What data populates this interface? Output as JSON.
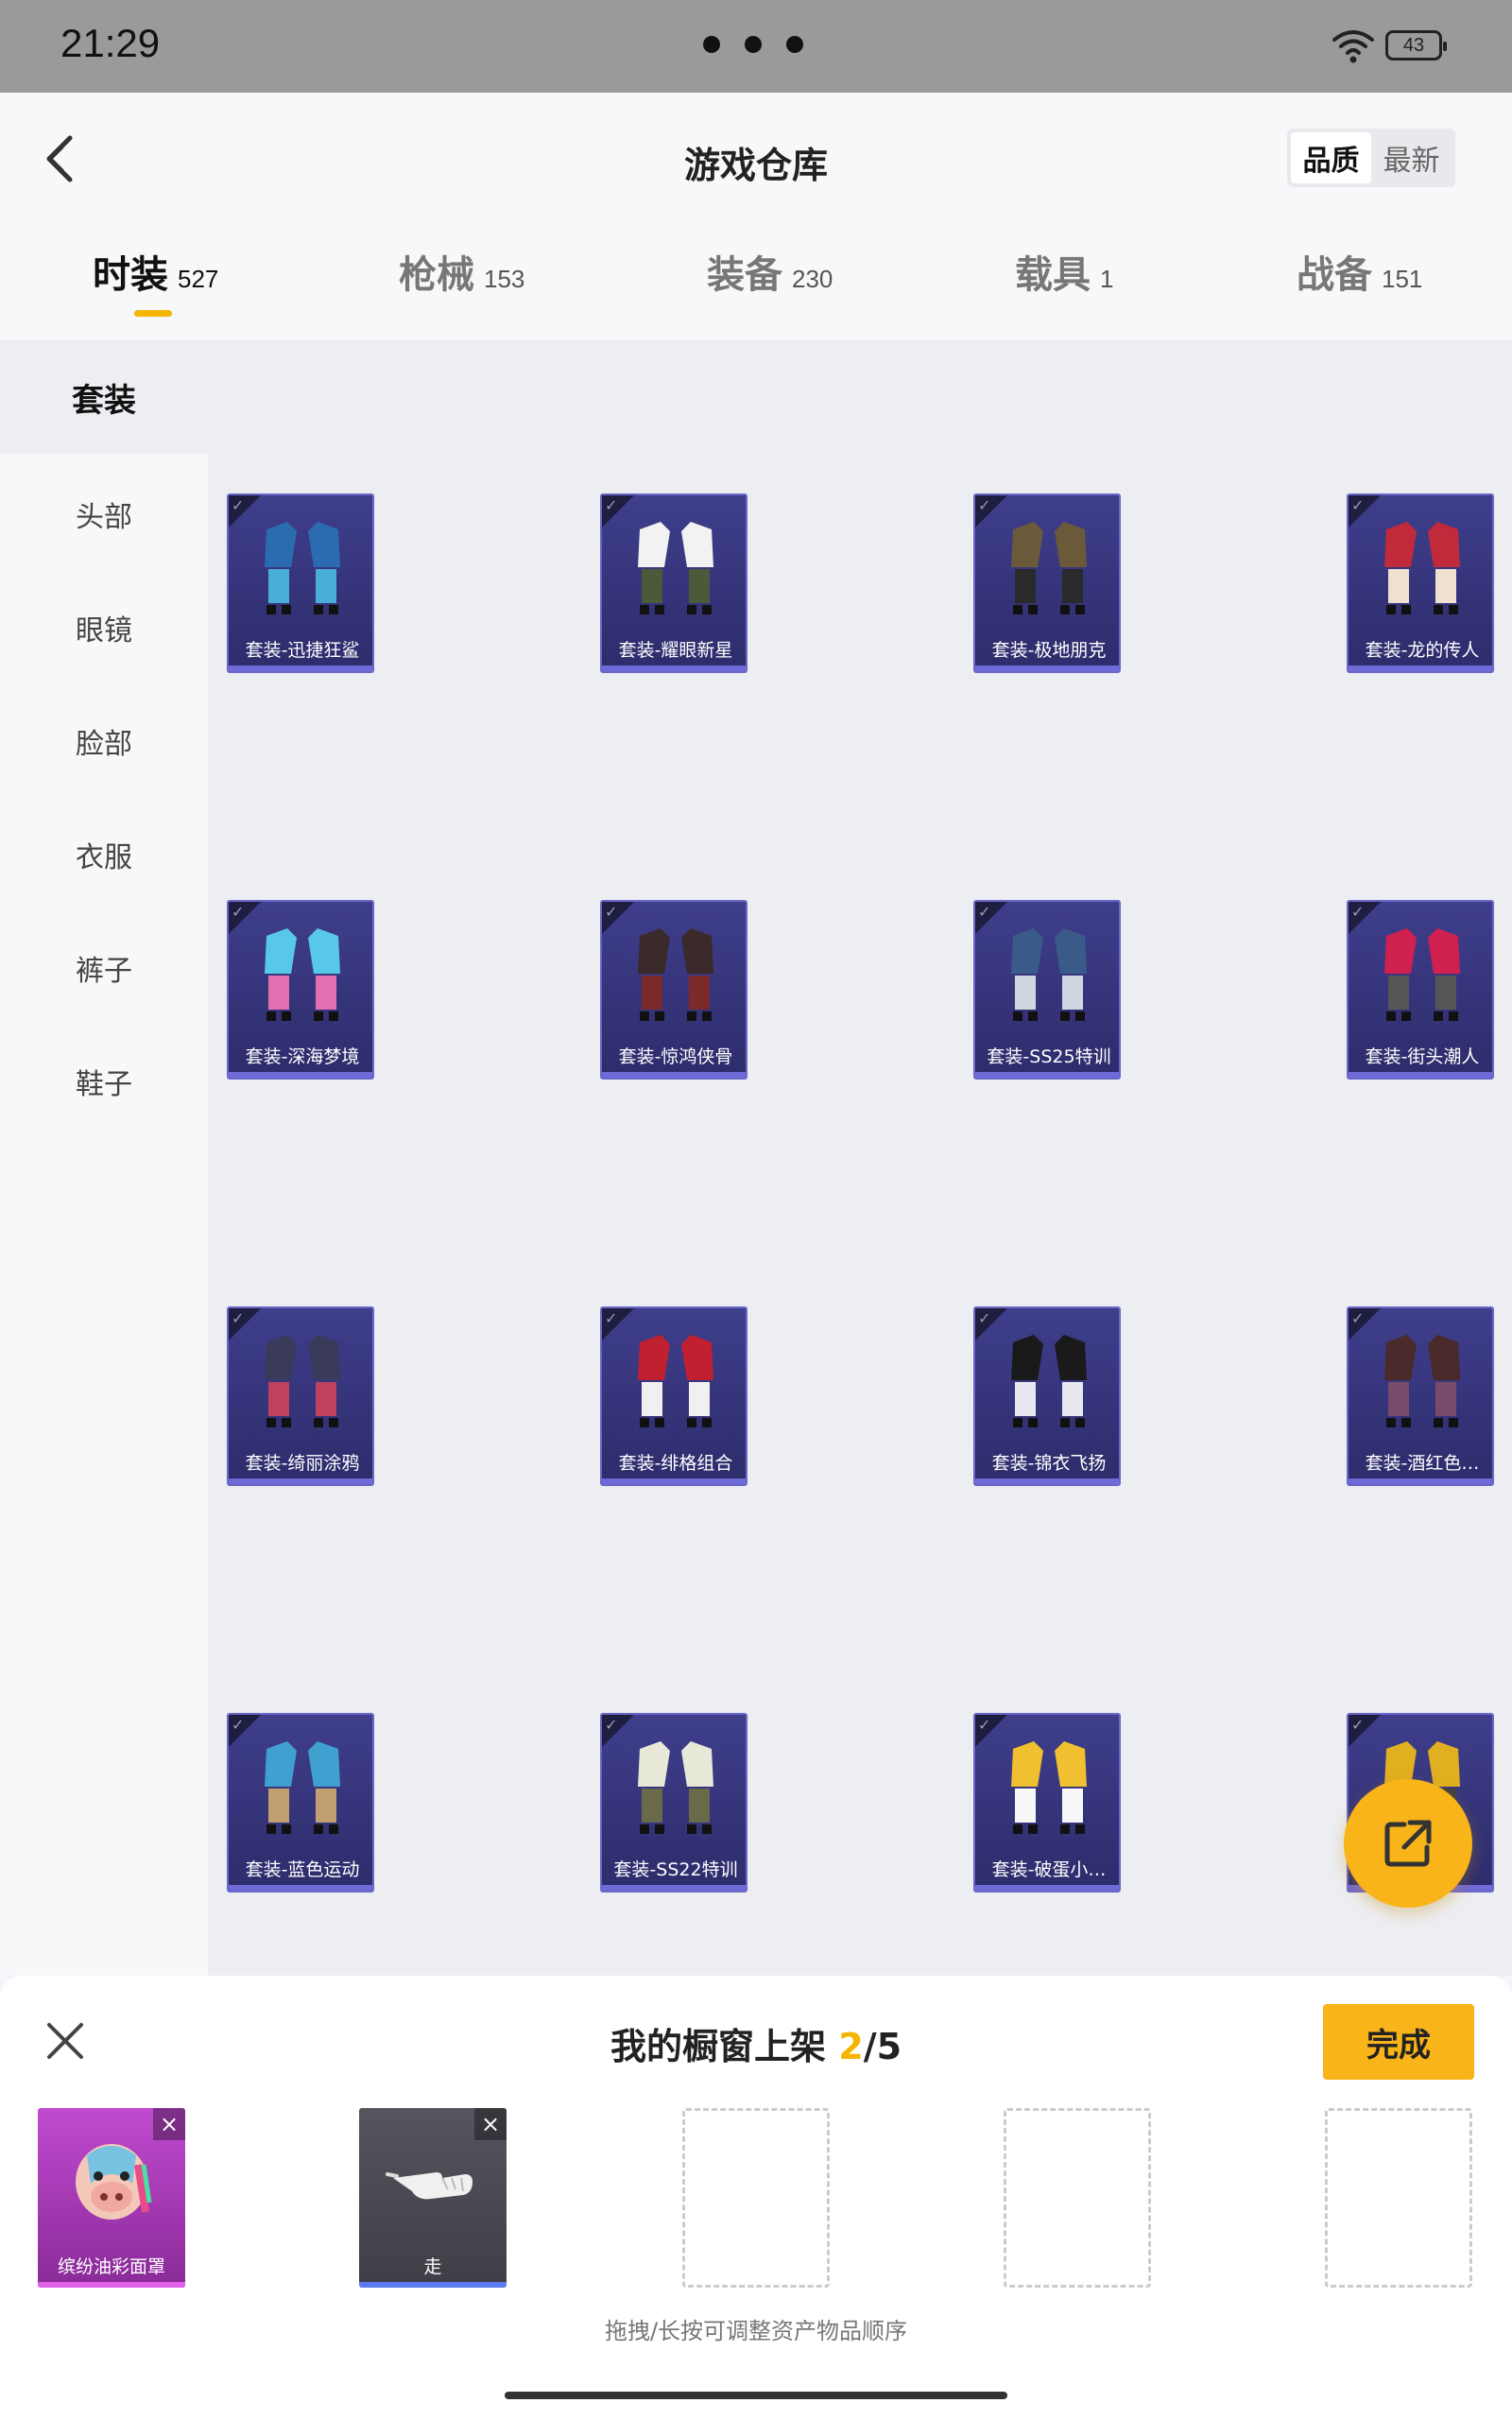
{
  "status": {
    "time": "21:29",
    "battery": "43"
  },
  "header": {
    "title": "游戏仓库",
    "sort_options": [
      "品质",
      "最新"
    ],
    "sort_active": 0
  },
  "tabs": [
    {
      "label": "时装",
      "count": "527",
      "active": true
    },
    {
      "label": "枪械",
      "count": "153"
    },
    {
      "label": "装备",
      "count": "230"
    },
    {
      "label": "载具",
      "count": "1"
    },
    {
      "label": "战备",
      "count": "151"
    }
  ],
  "sidebar": {
    "active": "套装",
    "items": [
      "头部",
      "眼镜",
      "脸部",
      "衣服",
      "裤子",
      "鞋子"
    ]
  },
  "items": [
    "套装-迅捷狂鲨",
    "套装-耀眼新星",
    "套装-极地朋克",
    "套装-龙的传人",
    "套装-深海梦境",
    "套装-惊鸿侠骨",
    "套装-SS25特训",
    "套装-街头潮人",
    "套装-绮丽涂鸦",
    "套装-绯格组合",
    "套装-锦衣飞扬",
    "套装-酒红色…",
    "套装-蓝色运动",
    "套装-SS22特训",
    "套装-破蛋小…",
    "套装-…"
  ],
  "item_colors": [
    [
      "#2b6cb0",
      "#48b0d8"
    ],
    [
      "#f2f2f2",
      "#4a5a3a"
    ],
    [
      "#6b5a3a",
      "#2a2a2a"
    ],
    [
      "#c02a3a",
      "#f0e0d0"
    ],
    [
      "#58c8e8",
      "#e070b0"
    ],
    [
      "#3a2a2a",
      "#7a2a2a"
    ],
    [
      "#3a5a8a",
      "#cfd8e0"
    ],
    [
      "#d02050",
      "#555"
    ],
    [
      "#3a3a5a",
      "#c04060"
    ],
    [
      "#c02030",
      "#f0f0f0"
    ],
    [
      "#1a1a1a",
      "#e8e8f0"
    ],
    [
      "#4a2a2a",
      "#7a4a6a"
    ],
    [
      "#40a0d0",
      "#c0a070"
    ],
    [
      "#e8e8d8",
      "#6a6a4a"
    ],
    [
      "#f0c030",
      "#f8f8f8"
    ],
    [
      "#e0b020",
      "#404040"
    ]
  ],
  "panel": {
    "title": "我的橱窗上架",
    "current": "2",
    "total": "/5",
    "done": "完成",
    "close": "×",
    "hint": "拖拽/长按可调整资产物品顺序",
    "slots": [
      {
        "label": "缤纷油彩面罩",
        "bg": "#b23ab8",
        "bar": "#e060e8"
      },
      {
        "label": "走",
        "bg": "#4a4a52",
        "bar": "#5b7cf0"
      }
    ]
  }
}
